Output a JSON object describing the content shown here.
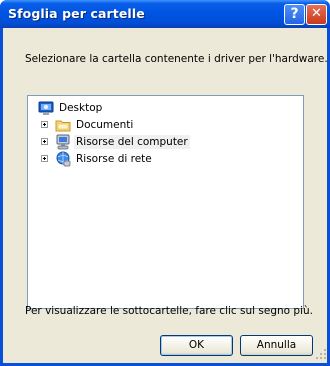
{
  "window": {
    "title": "Sfoglia per cartelle"
  },
  "titlebar_buttons": {
    "help_label": "?",
    "close_label": "✕"
  },
  "dialog": {
    "instruction": "Selezionare la cartella contenente i driver per l'hardware.",
    "hint": "Per visualizzare le sottocartelle, fare clic sul segno più."
  },
  "tree": {
    "items": [
      {
        "label": "Desktop",
        "icon": "desktop-icon",
        "expandable": false,
        "selected": false
      },
      {
        "label": "Documenti",
        "icon": "folder-icon",
        "expandable": true,
        "selected": false
      },
      {
        "label": "Risorse del computer",
        "icon": "computer-icon",
        "expandable": true,
        "selected": true
      },
      {
        "label": "Risorse di rete",
        "icon": "network-icon",
        "expandable": true,
        "selected": false
      }
    ]
  },
  "buttons": {
    "ok_label": "OK",
    "cancel_label": "Annulla"
  },
  "colors": {
    "titlebar": "#0054e3",
    "window_face": "#ece9d8",
    "tree_border": "#7f9db9"
  }
}
